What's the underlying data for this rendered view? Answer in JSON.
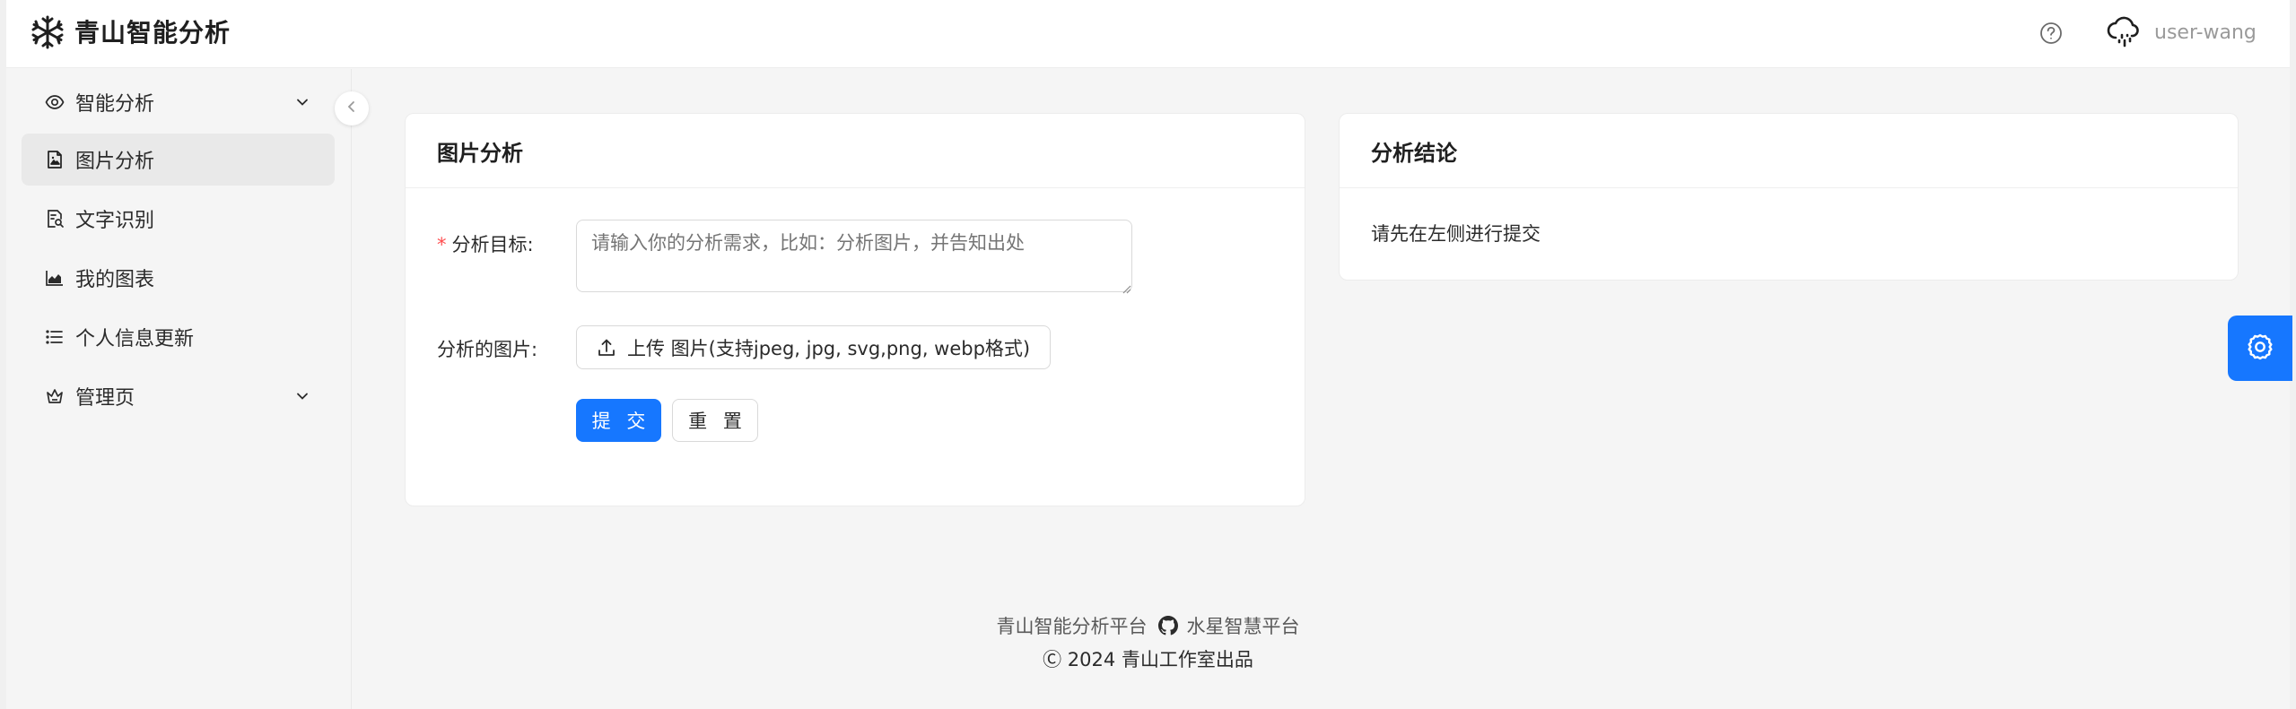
{
  "header": {
    "app_title": "青山智能分析",
    "username": "user-wang",
    "logo_icon": "snowflake-icon",
    "help_icon": "question-circle-icon",
    "avatar_icon": "cloud-rain-icon"
  },
  "sidebar": {
    "items": [
      {
        "label": "智能分析",
        "icon": "eye-icon",
        "has_submenu": true
      },
      {
        "label": "图片分析",
        "icon": "file-image-icon",
        "active": true
      },
      {
        "label": "文字识别",
        "icon": "file-search-icon"
      },
      {
        "label": "我的图表",
        "icon": "area-chart-icon"
      },
      {
        "label": "个人信息更新",
        "icon": "list-icon"
      },
      {
        "label": "管理页",
        "icon": "crown-icon",
        "has_submenu": true
      }
    ]
  },
  "image_card": {
    "title": "图片分析",
    "target_label": "分析目标:",
    "target_placeholder": "请输入你的分析需求，比如：分析图片，并告知出处",
    "image_label": "分析的图片:",
    "upload_label": "上传 图片(支持jpeg, jpg, svg,png, webp格式)",
    "submit_label": "提 交",
    "reset_label": "重 置"
  },
  "result_card": {
    "title": "分析结论",
    "message": "请先在左侧进行提交"
  },
  "footer": {
    "platform_link": "青山智能分析平台",
    "partner_link": "水星智慧平台",
    "copyright": "Ⓒ 2024 青山工作室出品"
  },
  "colors": {
    "primary": "#1677ff",
    "required": "#ff4d4f",
    "background": "#f5f5f5"
  }
}
